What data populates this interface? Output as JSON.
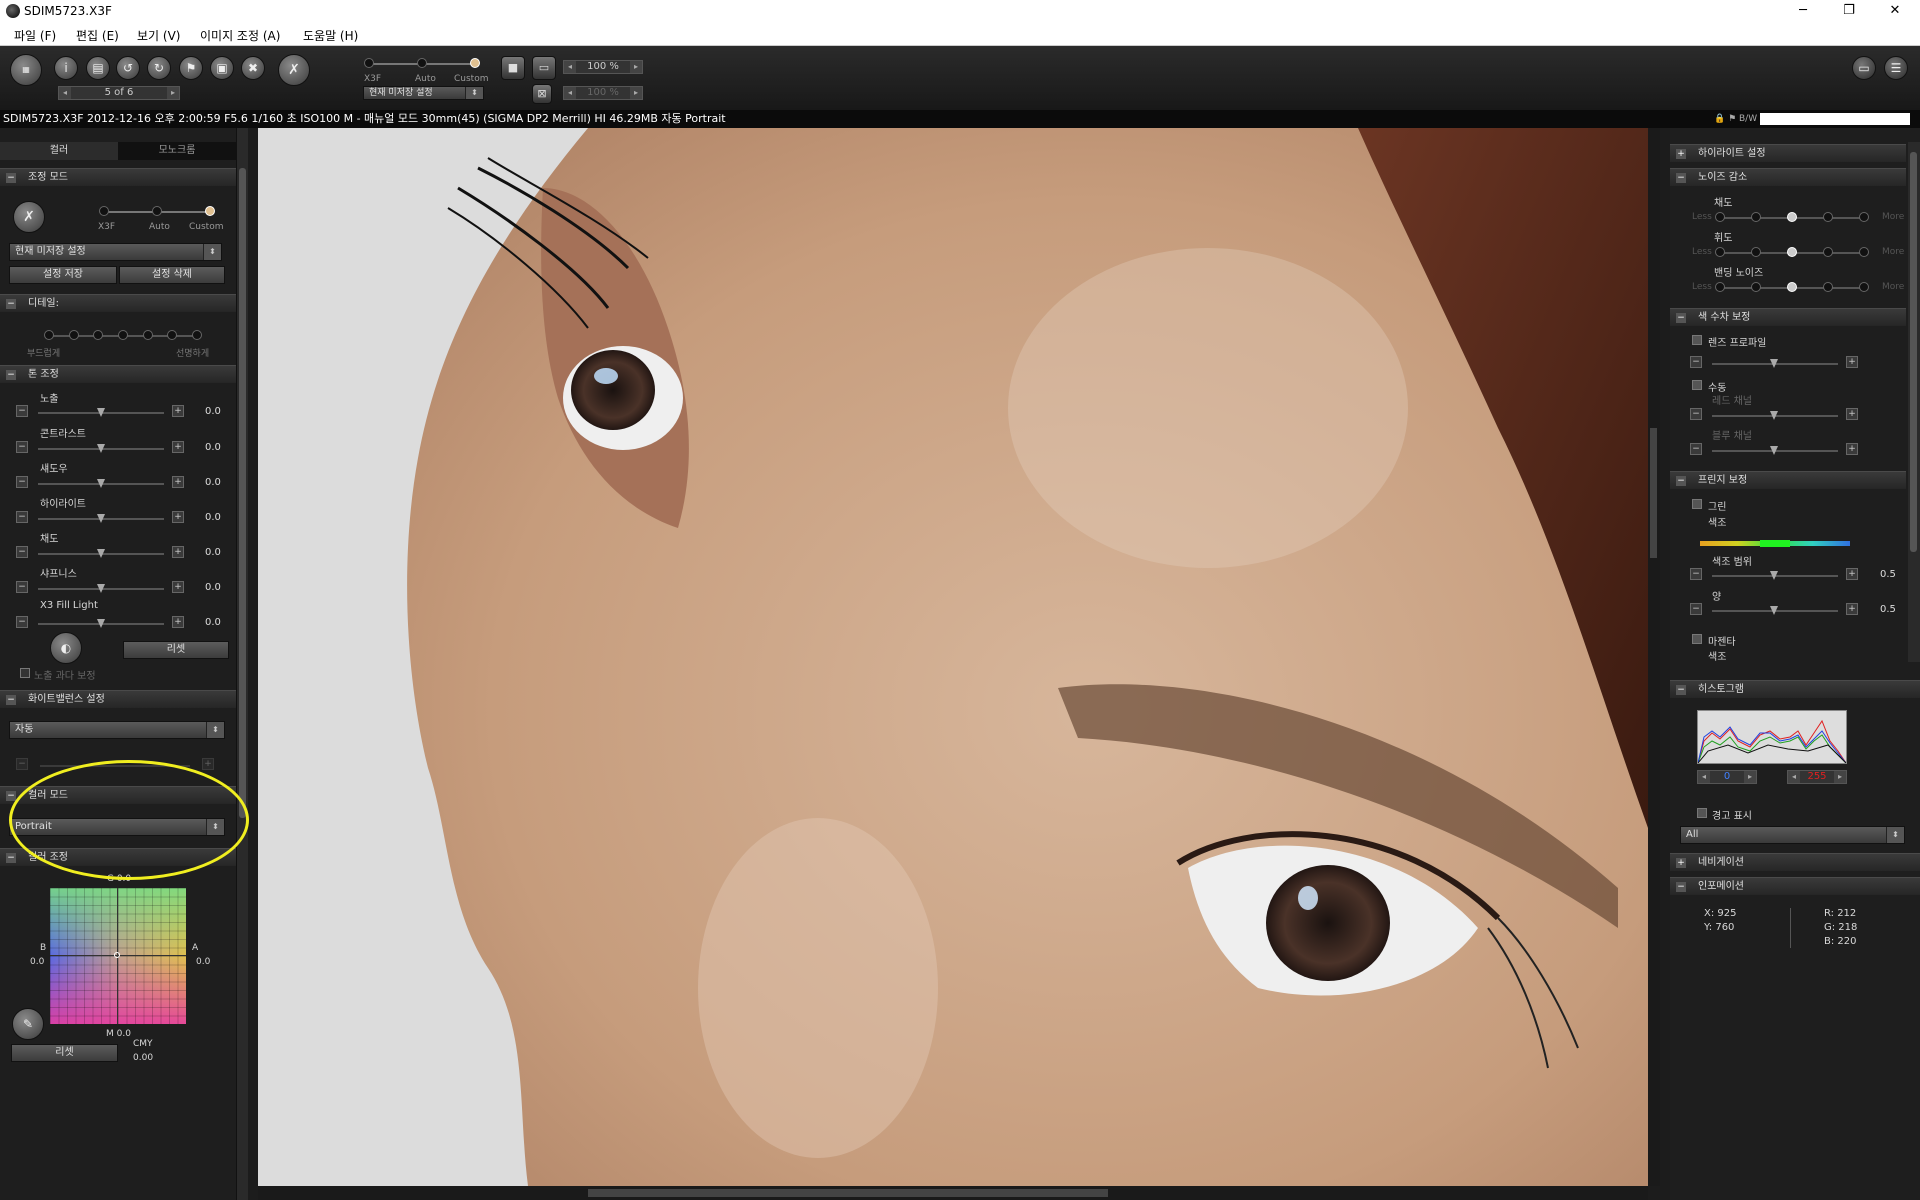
{
  "window": {
    "title": "SDIM5723.X3F",
    "minimize": "─",
    "maximize": "❐",
    "close": "✕"
  },
  "menu": [
    "파일 (F)",
    "편집 (E)",
    "보기 (V)",
    "이미지 조정 (A)",
    "도움말 (H)"
  ],
  "toolbar": {
    "nav_counter": "5 of 6",
    "mode_labels": [
      "X3F",
      "Auto",
      "Custom"
    ],
    "preset_combo": "현재 미저장 설정",
    "zoom_primary": "100 %",
    "zoom_secondary": "100 %"
  },
  "infobar": {
    "text": "SDIM5723.X3F 2012-12-16 오후 2:00:59 F5.6 1/160 초 ISO100 M - 매뉴얼 모드 30mm(45) (SIGMA DP2 Merrill) HI 46.29MB 자동 Portrait",
    "bw_label": "B/W"
  },
  "left": {
    "tabs": [
      "컬러",
      "모노크롬"
    ],
    "mode_section": {
      "title": "조정 모드",
      "labels": [
        "X3F",
        "Auto",
        "Custom"
      ],
      "preset": "현재 미저장 설정",
      "save": "설정 저장",
      "delete": "설정 삭제"
    },
    "detail_section": {
      "title": "디테일:",
      "left_label": "부드럽게",
      "right_label": "선명하게"
    },
    "tone_section": {
      "title": "톤 조정",
      "sliders": [
        {
          "label": "노출",
          "value": "0.0"
        },
        {
          "label": "콘트라스트",
          "value": "0.0"
        },
        {
          "label": "섀도우",
          "value": "0.0"
        },
        {
          "label": "하이라이트",
          "value": "0.0"
        },
        {
          "label": "채도",
          "value": "0.0"
        },
        {
          "label": "샤프니스",
          "value": "0.0"
        },
        {
          "label": "X3 Fill Light",
          "value": "0.0"
        }
      ],
      "reset": "리셋",
      "overexposure": "노출 과다 보정"
    },
    "wb_section": {
      "title": "화이트밸런스 설정",
      "value": "자동"
    },
    "color_mode_section": {
      "title": "컬러 모드",
      "value": "Portrait"
    },
    "color_adjust_section": {
      "title": "컬러 조정",
      "g": "G 0.0",
      "b_label": "B",
      "b_value": "0.0",
      "a_label": "A",
      "a_value": "0.0",
      "m": "M 0.0",
      "cmy_label": "CMY",
      "cmy_value": "0.00",
      "reset": "리셋"
    }
  },
  "right": {
    "highlight_section": "하이라이트 설정",
    "noise_section": {
      "title": "노이즈 감소",
      "rows": [
        {
          "label": "채도"
        },
        {
          "label": "휘도"
        },
        {
          "label": "밴딩 노이즈"
        }
      ],
      "less": "Less",
      "more": "More"
    },
    "aberration_section": {
      "title": "색 수차 보정",
      "lens_profile": "렌즈 프로파일",
      "manual": "수동",
      "red": "레드 채널",
      "blue": "블루 채널"
    },
    "fringe_section": {
      "title": "프린지 보정",
      "green": "그린",
      "hue": "색조",
      "hue_range": "색조 범위",
      "hue_range_value": "0.5",
      "amount": "양",
      "amount_value": "0.5",
      "magenta": "마젠타",
      "hue2": "색조"
    },
    "histogram_section": {
      "title": "히스토그램",
      "low": "0",
      "high": "255",
      "warning": "경고 표시",
      "channel": "All"
    },
    "navigation_section": "네비게이션",
    "info_section": {
      "title": "인포메이션",
      "x": "X:  925",
      "y": "Y:  760",
      "r": "R:  212",
      "g": "G:  218",
      "b": "B:  220"
    }
  }
}
